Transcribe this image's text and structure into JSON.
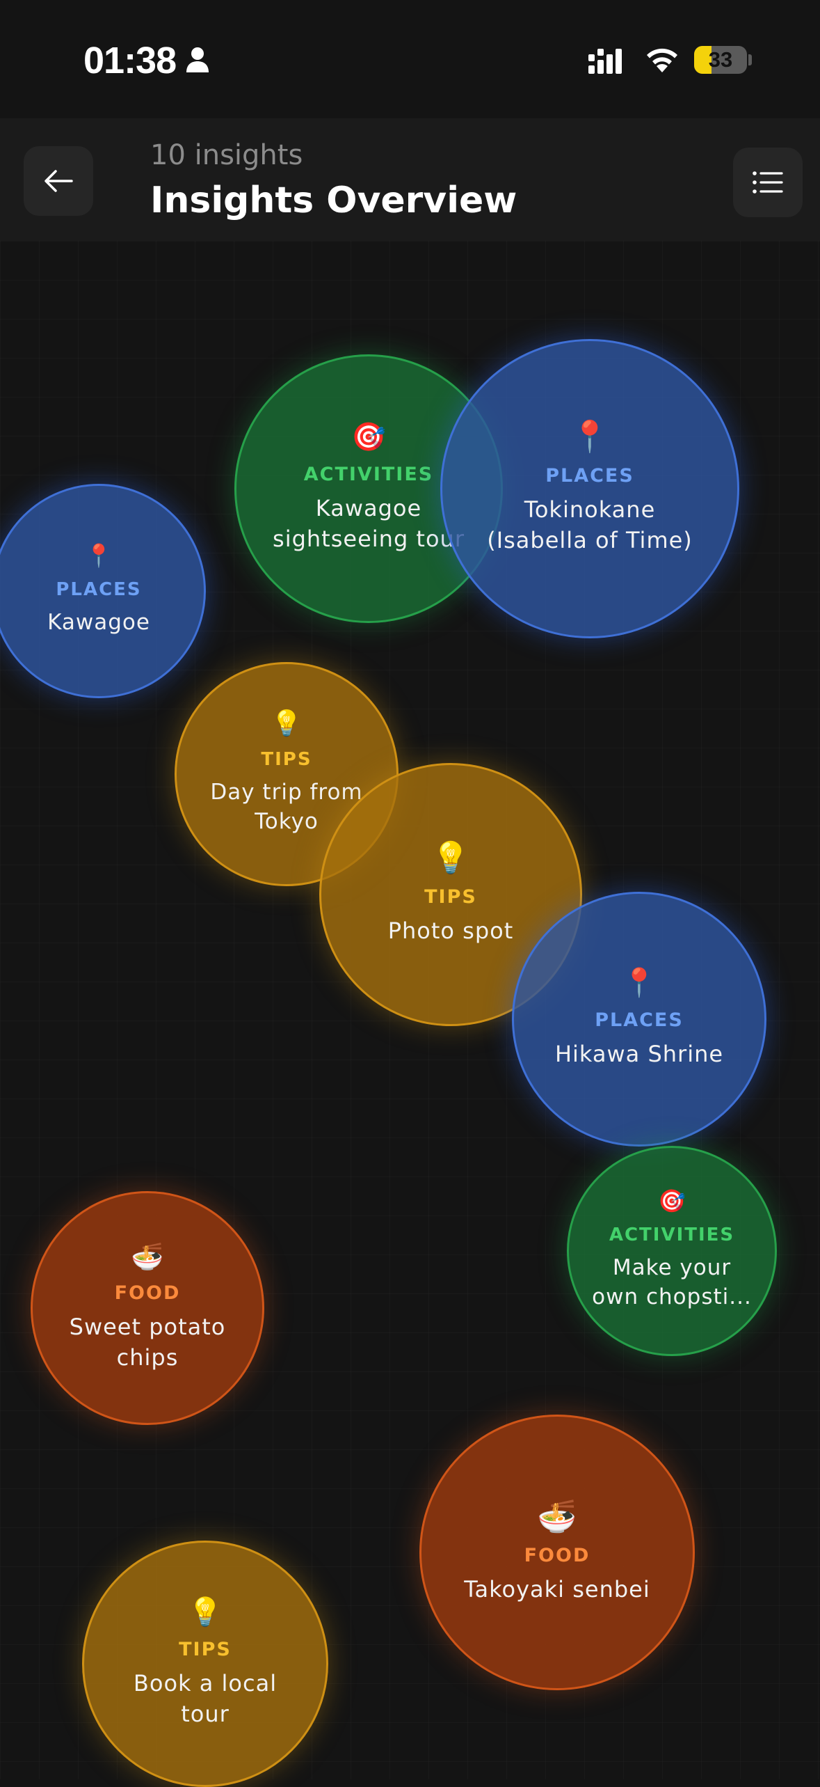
{
  "status": {
    "time": "01:38",
    "battery": "33",
    "battery_level": 0.33
  },
  "header": {
    "count_label": "10 insights",
    "title": "Insights Overview"
  },
  "icons": {
    "back": "arrow-left-icon",
    "menu": "list-icon",
    "places": "round-pushpin",
    "activities": "direct-hit",
    "tips": "light-bulb",
    "food": "bowl-with-spoon"
  },
  "colors": {
    "places": "#3f70d6",
    "activities": "#26a04a",
    "tips": "#cf9014",
    "food": "#d05518"
  },
  "insights": [
    {
      "category": "ACTIVITIES",
      "emoji": "🎯",
      "label": "Kawagoe sightseeing tour"
    },
    {
      "category": "PLACES",
      "emoji": "📍",
      "label": "Tokinokane (Isabella of Time)"
    },
    {
      "category": "PLACES",
      "emoji": "📍",
      "label": "Kawagoe"
    },
    {
      "category": "TIPS",
      "emoji": "💡",
      "label": "Day trip from Tokyo"
    },
    {
      "category": "TIPS",
      "emoji": "💡",
      "label": "Photo spot"
    },
    {
      "category": "PLACES",
      "emoji": "📍",
      "label": "Hikawa Shrine"
    },
    {
      "category": "ACTIVITIES",
      "emoji": "🎯",
      "label": "Make your own chopsti..."
    },
    {
      "category": "FOOD",
      "emoji": "🍜",
      "label": "Sweet potato chips"
    },
    {
      "category": "FOOD",
      "emoji": "🍜",
      "label": "Takoyaki senbei"
    },
    {
      "category": "TIPS",
      "emoji": "💡",
      "label": "Book a local tour"
    }
  ]
}
